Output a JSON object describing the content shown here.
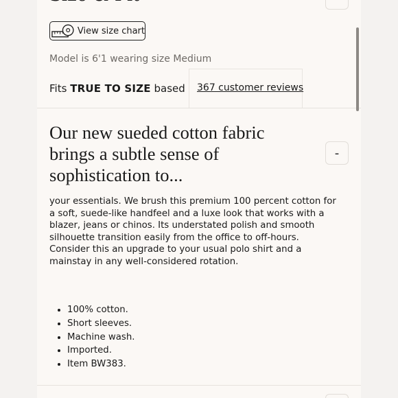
{
  "size_fit": {
    "section_title": "Size & Fit",
    "size_chart_label": "View size chart",
    "model_note": "Model is 6'1 wearing size Medium",
    "fit_prefix": "Fits",
    "fit_value": "TRUE TO SIZE",
    "fit_suffix": "based on",
    "reviews_link": "367 customer reviews"
  },
  "description": {
    "heading": "Our new sueded cotton fabric brings a subtle sense of sophistication to...",
    "toggle_label": "-",
    "body": "your essentials. We brush this premium 100 percent cotton for a soft, suede-like handfeel and a luxe look that works with a blazer, jeans or chinos. Its understated polish and smooth silhouette transition easily from the office to off-hours. Consider this an upgrade to your usual polo shirt and a mainstay in any well-considered rotation.",
    "details": [
      "100% cotton.",
      "Short sleeves.",
      "Machine wash.",
      "Imported.",
      "Item BW383."
    ]
  },
  "icons": {
    "size_chart": "measuring-tape-icon",
    "collapse": "minus-icon"
  }
}
